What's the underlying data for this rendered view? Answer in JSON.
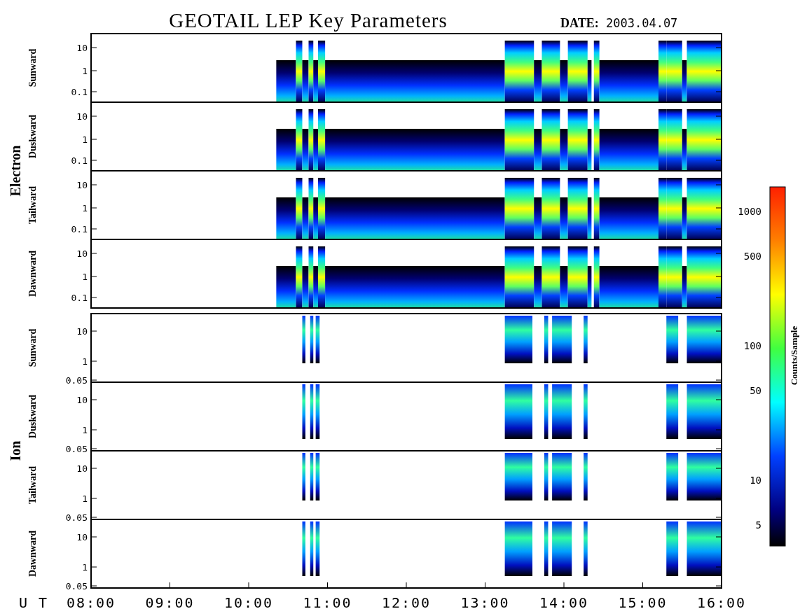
{
  "title": "GEOTAIL LEP Key Parameters",
  "date_label": "DATE:",
  "date": "2003.04.07",
  "groups": [
    {
      "name": "Electron",
      "kind": "electron",
      "panels": [
        {
          "label": "Sunward",
          "yticks": [
            "10",
            "1",
            "0.1"
          ]
        },
        {
          "label": "Duskward",
          "yticks": [
            "10",
            "1",
            "0.1"
          ]
        },
        {
          "label": "Tailward",
          "yticks": [
            "10",
            "1",
            "0.1"
          ]
        },
        {
          "label": "Dawnward",
          "yticks": [
            "10",
            "1",
            "0.1"
          ]
        }
      ]
    },
    {
      "name": "Ion",
      "kind": "ion",
      "panels": [
        {
          "label": "Sunward",
          "yticks": [
            "10",
            "1",
            "0.05"
          ]
        },
        {
          "label": "Duskward",
          "yticks": [
            "10",
            "1",
            "0.05"
          ]
        },
        {
          "label": "Tailward",
          "yticks": [
            "10",
            "1",
            "0.05"
          ]
        },
        {
          "label": "Dawnward",
          "yticks": [
            "10",
            "1",
            "0.05"
          ]
        }
      ]
    }
  ],
  "colorbar": {
    "title": "Counts/Sample",
    "ticks": [
      "1000",
      "500",
      "100",
      "50",
      "10",
      "5"
    ]
  },
  "x_axis": {
    "label": "U T",
    "ticks": [
      "08:00",
      "09:00",
      "10:00",
      "11:00",
      "12:00",
      "13:00",
      "14:00",
      "15:00",
      "16:00"
    ]
  }
}
